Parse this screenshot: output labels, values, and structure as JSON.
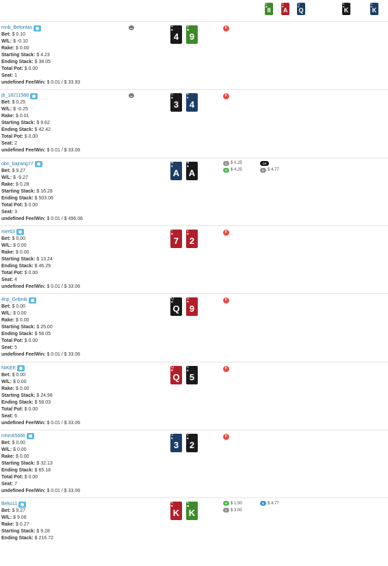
{
  "board": [
    {
      "rank": "8",
      "suit": "♣",
      "color": "green"
    },
    {
      "rank": "A",
      "suit": "♥",
      "color": "red"
    },
    {
      "rank": "Q",
      "suit": "♦",
      "color": "blue"
    },
    {
      "rank": "K",
      "suit": "♠",
      "color": "black"
    },
    {
      "rank": "K",
      "suit": "♦",
      "color": "blue"
    }
  ],
  "labels": {
    "bet": "Bet:",
    "wl": "W/L:",
    "rake": "Rake:",
    "starting": "Starting Stack:",
    "ending": "Ending Stack:",
    "totalpot": "Total Pot:",
    "seat": "Seat:",
    "feewin": "undefined Fee/Win:"
  },
  "players": [
    {
      "name": "mnb_Betontas",
      "bet": "$ 0.10",
      "wl": "$ -0.10",
      "rake": "$ 0.00",
      "starting": "$ 4.23",
      "ending": "$ 38.05",
      "totalpot": "$ 0.00",
      "seat": "1",
      "feewin": "$ 0.01 / $ 33.93",
      "dealer": true,
      "cards": [
        {
          "rank": "4",
          "suit": "♠",
          "color": "black"
        },
        {
          "rank": "9",
          "suit": "♣",
          "color": "green"
        }
      ],
      "fold": "F"
    },
    {
      "name": "jb_18211588",
      "bet": "$ 0.25",
      "wl": "$ -0.25",
      "rake": "$ 0.01",
      "starting": "$ 9.62",
      "ending": "$ 42.42",
      "totalpot": "$ 0.00",
      "seat": "2",
      "feewin": "$ 0.01 / $ 33.06",
      "dealer": true,
      "cards": [
        {
          "rank": "3",
          "suit": "♠",
          "color": "black"
        },
        {
          "rank": "4",
          "suit": "♦",
          "color": "blue"
        }
      ],
      "fold": "F"
    },
    {
      "name": "obn_bajrang77",
      "bet": "$ 9.27",
      "wl": "$ -9.27",
      "rake": "$ 0.28",
      "starting": "$ 16.28",
      "ending": "$ 503.06",
      "totalpot": "$ 0.00",
      "seat": "3",
      "feewin": "$ 0.01 / $ 496.06",
      "dealer": false,
      "cards": [
        {
          "rank": "A",
          "suit": "♦",
          "color": "blue"
        },
        {
          "rank": "A",
          "suit": "♠",
          "color": "black"
        }
      ],
      "actions": [
        {
          "code": "C",
          "color": "gray",
          "amount": "$ 0.25"
        },
        {
          "code": "R",
          "color": "green",
          "amount": "$ 4.25"
        },
        {
          "code": "CH",
          "color": "black",
          "amount": ""
        },
        {
          "code": "C",
          "color": "gray",
          "amount": "$ 4.77"
        }
      ]
    },
    {
      "name": "mer63",
      "bet": "$ 0.00",
      "wl": "$ 0.00",
      "rake": "$ 0.00",
      "starting": "$ 13.24",
      "ending": "$ 46.29",
      "totalpot": "$ 0.00",
      "seat": "4",
      "feewin": "$ 0.01 / $ 33.06",
      "dealer": false,
      "cards": [
        {
          "rank": "7",
          "suit": "♥",
          "color": "red"
        },
        {
          "rank": "2",
          "suit": "♥",
          "color": "red"
        }
      ],
      "fold": "F"
    },
    {
      "name": "4np_Gribnik",
      "bet": "$ 0.00",
      "wl": "$ 0.00",
      "rake": "$ 0.00",
      "starting": "$ 25.00",
      "ending": "$ 58.05",
      "totalpot": "$ 0.00",
      "seat": "5",
      "feewin": "$ 0.01 / $ 33.06",
      "dealer": false,
      "cards": [
        {
          "rank": "Q",
          "suit": "♠",
          "color": "black"
        },
        {
          "rank": "9",
          "suit": "♥",
          "color": "red"
        }
      ],
      "fold": "F"
    },
    {
      "name": "NIKEE",
      "bet": "$ 0.00",
      "wl": "$ 0.00",
      "rake": "$ 0.00",
      "starting": "$ 24.98",
      "ending": "$ 58.03",
      "totalpot": "$ 0.00",
      "seat": "6",
      "feewin": "$ 0.01 / $ 33.06",
      "dealer": false,
      "cards": [
        {
          "rank": "Q",
          "suit": "♥",
          "color": "red"
        },
        {
          "rank": "5",
          "suit": "♠",
          "color": "black"
        }
      ],
      "fold": "F"
    },
    {
      "name": "mhm65666",
      "bet": "$ 0.00",
      "wl": "$ 0.00",
      "rake": "$ 0.00",
      "starting": "$ 32.13",
      "ending": "$ 65.18",
      "totalpot": "$ 0.00",
      "seat": "7",
      "feewin": "$ 0.01 / $ 33.06",
      "dealer": false,
      "cards": [
        {
          "rank": "3",
          "suit": "♦",
          "color": "blue"
        },
        {
          "rank": "2",
          "suit": "♠",
          "color": "black"
        }
      ],
      "fold": "F"
    },
    {
      "name": "Beko11",
      "bet": "$ 9.27",
      "wl": "$ 9.06",
      "rake": "$ 0.27",
      "starting": "$ 9.28",
      "ending": "$ 216.72",
      "totalpot": "",
      "seat": "",
      "feewin": "",
      "dealer": false,
      "cards": [
        {
          "rank": "K",
          "suit": "♥",
          "color": "red"
        },
        {
          "rank": "K",
          "suit": "♣",
          "color": "green"
        }
      ],
      "actions": [
        {
          "code": "R",
          "color": "green",
          "amount": "$ 1.50"
        },
        {
          "code": "C",
          "color": "gray",
          "amount": "$ 3.00"
        },
        {
          "code": "B",
          "color": "blue",
          "amount": "$ 4.77"
        }
      ]
    }
  ]
}
